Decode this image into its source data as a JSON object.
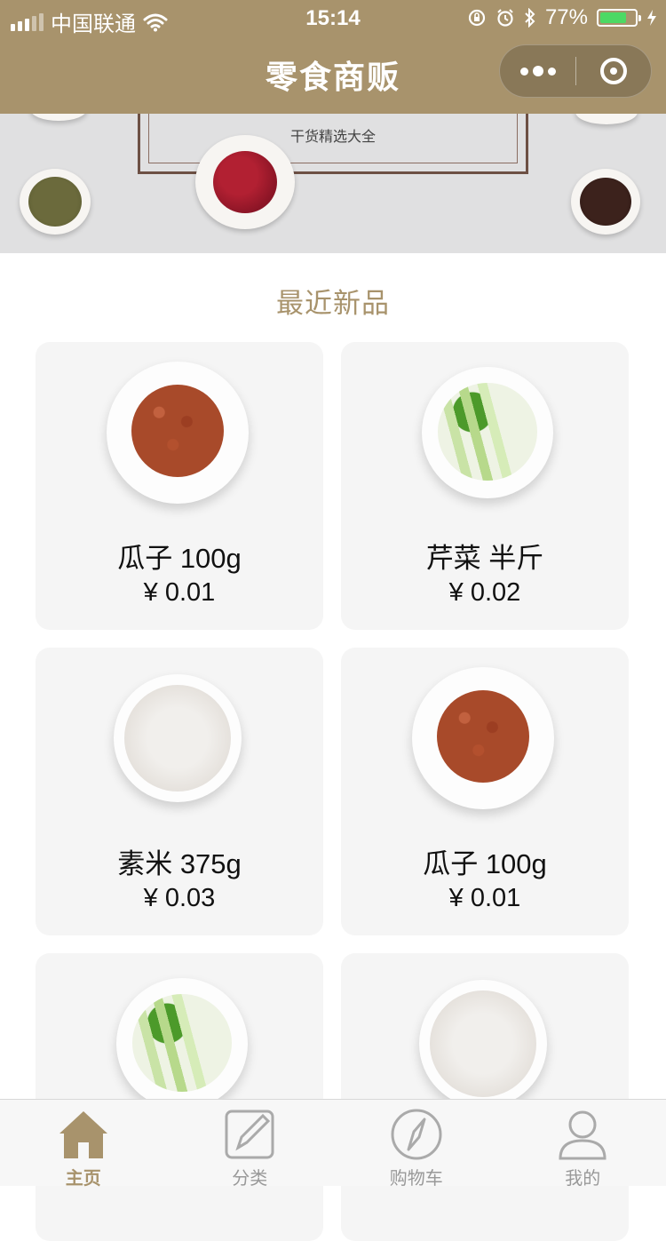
{
  "status_bar": {
    "carrier": "中国联通",
    "time": "15:14",
    "battery_percent": "77%",
    "battery_level": 0.77
  },
  "nav": {
    "title": "零食商贩"
  },
  "banner": {
    "caption": "干货精选大全"
  },
  "section": {
    "title": "最近新品"
  },
  "products": [
    {
      "name": "瓜子 100g",
      "price": "¥ 0.01",
      "image": "seeds"
    },
    {
      "name": "芹菜 半斤",
      "price": "¥ 0.02",
      "image": "celery"
    },
    {
      "name": "素米 375g",
      "price": "¥ 0.03",
      "image": "rice"
    },
    {
      "name": "瓜子 100g",
      "price": "¥ 0.01",
      "image": "seeds"
    },
    {
      "name": "",
      "price": "",
      "image": "celery"
    },
    {
      "name": "",
      "price": "",
      "image": "rice"
    }
  ],
  "tabbar": {
    "items": [
      {
        "label": "主页",
        "icon": "home-icon",
        "active": true
      },
      {
        "label": "分类",
        "icon": "edit-icon",
        "active": false
      },
      {
        "label": "购物车",
        "icon": "compass-icon",
        "active": false
      },
      {
        "label": "我的",
        "icon": "user-icon",
        "active": false
      }
    ]
  },
  "colors": {
    "brand": "#a8936c",
    "card_bg": "#f5f5f5",
    "banner_bg": "#e0e0e1"
  }
}
